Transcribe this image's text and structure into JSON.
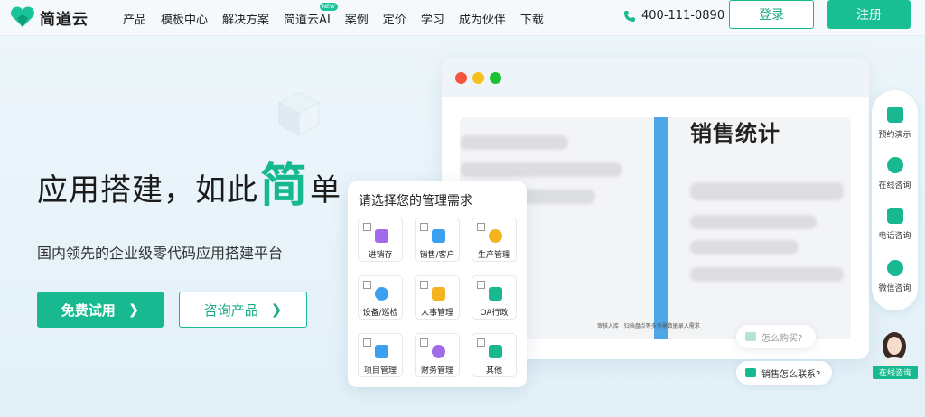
{
  "header": {
    "logo_text": "简道云",
    "nav": [
      {
        "label": "产品"
      },
      {
        "label": "模板中心"
      },
      {
        "label": "解决方案"
      },
      {
        "label": "简道云AI",
        "badge": "NEW"
      },
      {
        "label": "案例"
      },
      {
        "label": "定价"
      },
      {
        "label": "学习"
      },
      {
        "label": "成为伙伴"
      },
      {
        "label": "下载"
      }
    ],
    "phone": "400-111-0890",
    "login_label": "登录",
    "register_label": "注册"
  },
  "hero": {
    "title_part1": "应用搭建，如此",
    "title_highlight": "简",
    "title_part2": "单",
    "subtitle": "国内领先的企业级零代码应用搭建平台",
    "try_button": "免费试用",
    "consult_button": "咨询产品"
  },
  "mockup": {
    "screen_title": "销售统计",
    "caption": "审核入库 · 归档盘点等多场景数据录入需求"
  },
  "needs_panel": {
    "title": "请选择您的管理需求",
    "options": [
      {
        "label": "进销存",
        "icon": "warehouse-icon",
        "color": "#a06ae8"
      },
      {
        "label": "销售/客户",
        "icon": "sales-icon",
        "color": "#3aa0ef"
      },
      {
        "label": "生产管理",
        "icon": "production-icon",
        "color": "#f5b31f"
      },
      {
        "label": "设备/巡检",
        "icon": "inspect-icon",
        "color": "#3aa0ef"
      },
      {
        "label": "人事管理",
        "icon": "hr-icon",
        "color": "#f5b31f"
      },
      {
        "label": "OA行政",
        "icon": "oa-icon",
        "color": "#18b990"
      },
      {
        "label": "项目管理",
        "icon": "project-icon",
        "color": "#3aa0ef"
      },
      {
        "label": "财务管理",
        "icon": "finance-icon",
        "color": "#a06ae8"
      },
      {
        "label": "其他",
        "icon": "other-icon",
        "color": "#18b990"
      }
    ]
  },
  "contact_bar": {
    "items": [
      {
        "label": "预约演示",
        "icon": "demo-icon"
      },
      {
        "label": "在线咨询",
        "icon": "chat-icon"
      },
      {
        "label": "电话咨询",
        "icon": "phone-icon"
      },
      {
        "label": "微信咨询",
        "icon": "wechat-icon"
      }
    ]
  },
  "bubbles": {
    "how_to_buy": "怎么购买?",
    "contact_sales": "销售怎么联系?"
  },
  "online_consult": "在线咨询",
  "colors": {
    "brand": "#18b990",
    "blue": "#4fa6e6"
  }
}
